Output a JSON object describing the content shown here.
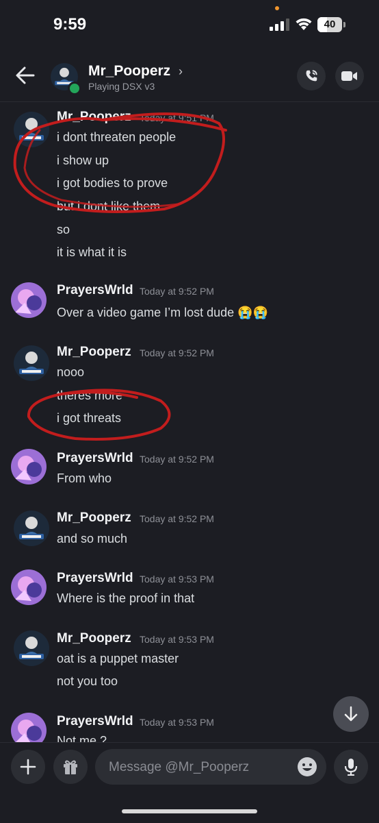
{
  "status_bar": {
    "time": "9:59",
    "battery": "40"
  },
  "header": {
    "name": "Mr_Pooperz",
    "chevron": "›",
    "status": "Playing DSX v3",
    "icons": [
      "arrow-left-icon",
      "phone-icon",
      "video-camera-icon"
    ]
  },
  "messages": [
    {
      "author": "Mr_Pooperz",
      "timestamp": "Today at 9:51 PM",
      "lines": [
        "i dont threaten people",
        "i show up",
        "i got bodies to prove",
        "but i dont like them",
        "so",
        "it is what it is"
      ]
    },
    {
      "author": "PrayersWrld",
      "timestamp": "Today at 9:52 PM",
      "lines": [
        "Over a video game I’m lost dude 😭😭"
      ]
    },
    {
      "author": "Mr_Pooperz",
      "timestamp": "Today at 9:52 PM",
      "lines": [
        "nooo",
        "theres more",
        "i got threats"
      ]
    },
    {
      "author": "PrayersWrld",
      "timestamp": "Today at 9:52 PM",
      "lines": [
        "From who"
      ]
    },
    {
      "author": "Mr_Pooperz",
      "timestamp": "Today at 9:52 PM",
      "lines": [
        "and so much"
      ]
    },
    {
      "author": "PrayersWrld",
      "timestamp": "Today at 9:53 PM",
      "lines": [
        "Where is the proof in that"
      ]
    },
    {
      "author": "Mr_Pooperz",
      "timestamp": "Today at 9:53 PM",
      "lines": [
        "oat is a puppet master",
        "not you too"
      ]
    },
    {
      "author": "PrayersWrld",
      "timestamp": "Today at 9:53 PM",
      "lines": [
        "Not me ?"
      ]
    }
  ],
  "input": {
    "placeholder": "Message @Mr_Pooperz"
  },
  "colors": {
    "background": "#1c1d23",
    "online": "#23a55a",
    "annotation": "#c21d1d",
    "field": "#2c2e34"
  }
}
